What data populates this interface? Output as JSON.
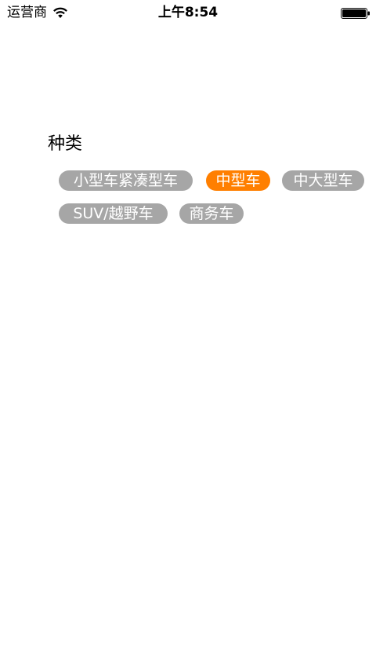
{
  "status_bar": {
    "carrier": "运营商",
    "time": "上午8:54",
    "wifi_icon": "wifi-icon",
    "battery_icon": "battery-icon"
  },
  "category": {
    "title": "种类",
    "selected_color": "#ff7f00",
    "unselected_color": "#a6a6a6",
    "tags": [
      {
        "label": "小型车紧凑型车",
        "selected": false
      },
      {
        "label": "中型车",
        "selected": true
      },
      {
        "label": "中大型车",
        "selected": false
      },
      {
        "label": "SUV/越野车",
        "selected": false
      },
      {
        "label": "商务车",
        "selected": false
      }
    ]
  }
}
